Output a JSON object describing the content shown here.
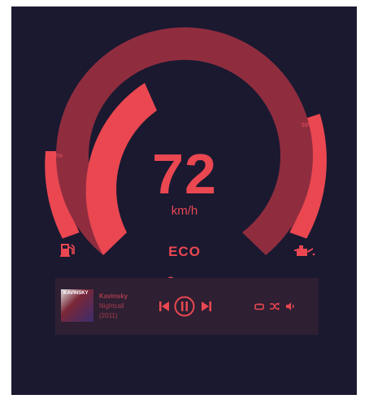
{
  "speed": {
    "value": "72",
    "unit": "km/h"
  },
  "drive_mode": "ECO",
  "fuel": {
    "percent_label": "42%",
    "level": 0.42,
    "icon": "fuel-pump-icon"
  },
  "oil": {
    "percent_label": "93%",
    "level": 0.93,
    "icon": "oil-can-icon"
  },
  "speed_gauge": {
    "level": 0.3
  },
  "player": {
    "artist": "Kavinsky",
    "track": "Nightcall",
    "year": "(2011)",
    "album_art_text": "KAVINSKY",
    "progress": 0.43,
    "icons": [
      "skip-back-icon",
      "pause-icon",
      "skip-forward-icon",
      "repeat-icon",
      "shuffle-icon",
      "volume-icon"
    ]
  },
  "colors": {
    "background": "#1a1930",
    "accent": "#ea4751",
    "accent_dim": "#8f2d3f",
    "player_bg": "#2e1f32"
  }
}
